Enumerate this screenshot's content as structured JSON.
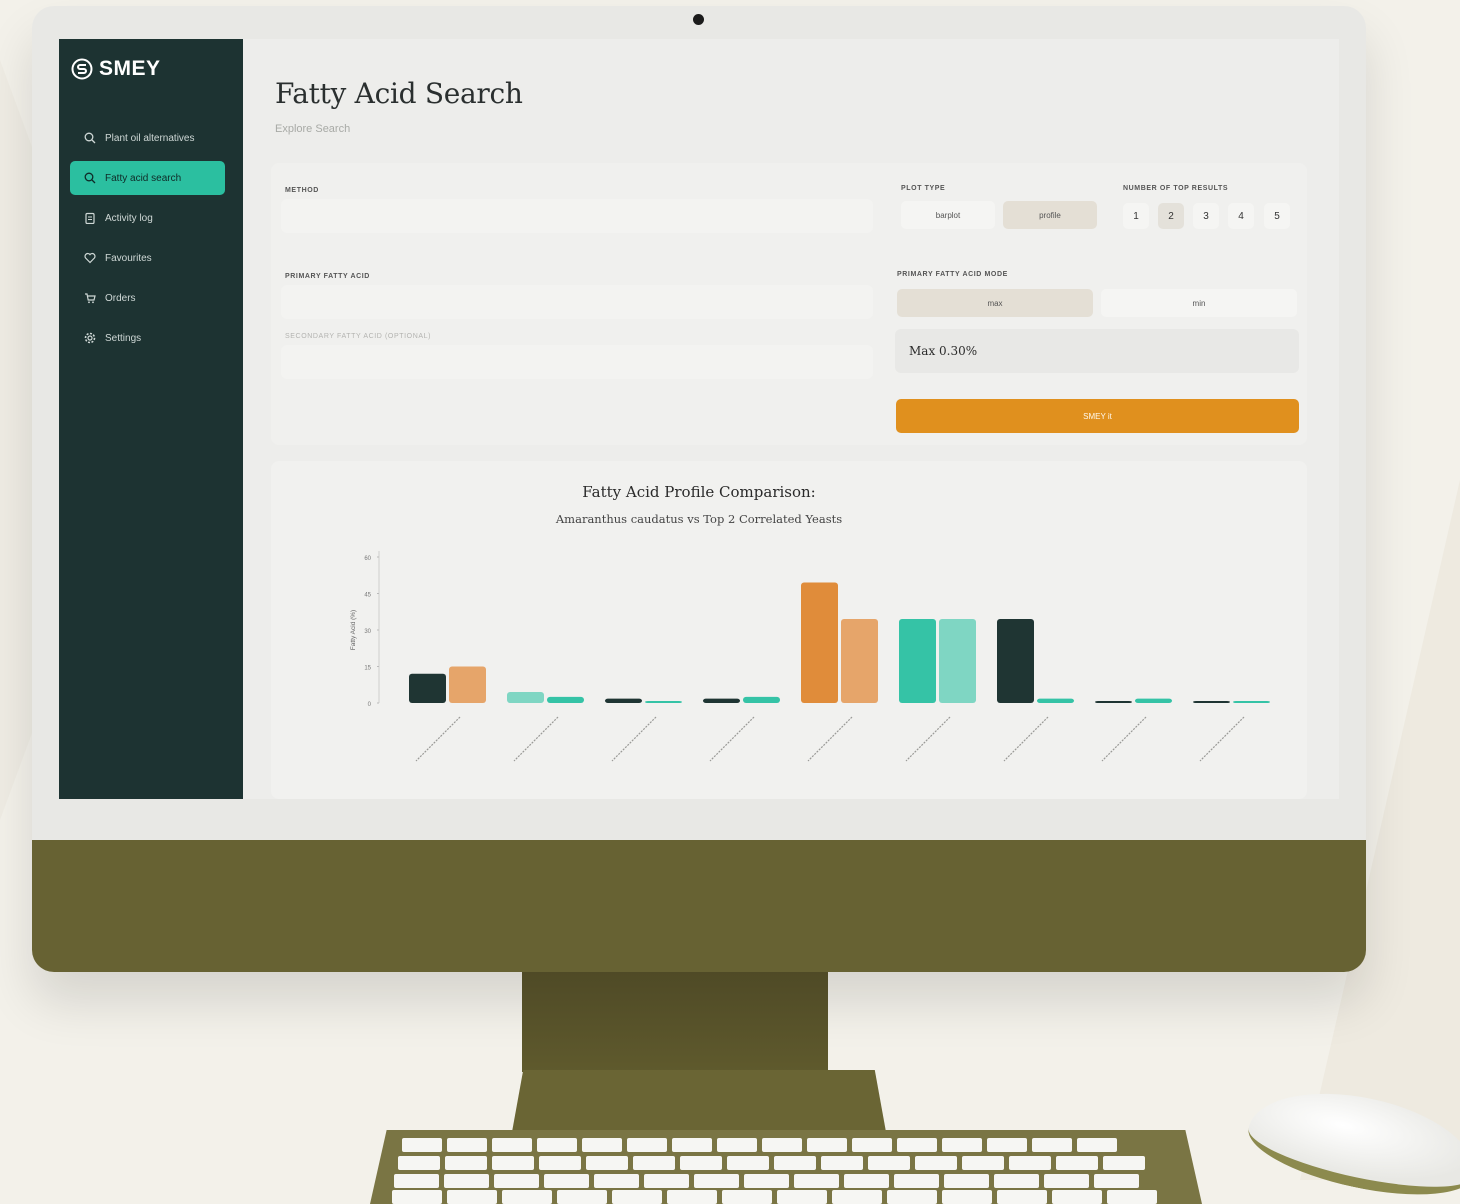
{
  "brand": {
    "name": "SMEY"
  },
  "sidebar": {
    "items": [
      {
        "label": "Plant oil alternatives",
        "icon": "search-icon",
        "active": false
      },
      {
        "label": "Fatty acid search",
        "icon": "search-icon",
        "active": true
      },
      {
        "label": "Activity log",
        "icon": "clipboard-icon",
        "active": false
      },
      {
        "label": "Favourites",
        "icon": "heart-icon",
        "active": false
      },
      {
        "label": "Orders",
        "icon": "cart-icon",
        "active": false
      },
      {
        "label": "Settings",
        "icon": "gear-icon",
        "active": false
      }
    ]
  },
  "page": {
    "title": "Fatty Acid Search",
    "breadcrumb": "Explore Search"
  },
  "form": {
    "method_label": "METHOD",
    "plot_type_label": "PLOT TYPE",
    "plot_types": [
      "barplot",
      "profile"
    ],
    "plot_type_selected": "profile",
    "top_results_label": "NUMBER OF TOP RESULTS",
    "top_results_options": [
      "1",
      "2",
      "3",
      "4",
      "5"
    ],
    "top_results_selected": "2",
    "primary_label": "PRIMARY FATTY ACID",
    "primary_mode_label": "PRIMARY FATTY ACID MODE",
    "modes": [
      "max",
      "min"
    ],
    "mode_selected": "max",
    "secondary_label": "SECONDARY FATTY ACID (OPTIONAL)",
    "max_value": "Max 0.30%",
    "submit_label": "SMEY it"
  },
  "colors": {
    "sidebar": "#1d3332",
    "accent": "#2bbfa0",
    "orange": "#e0901e",
    "dark_series": "#1f3533",
    "orange_series": "#e08c3a",
    "orange_light": "#e6a56a",
    "teal_series": "#35c3a6",
    "teal_light": "#7fd6c3"
  },
  "chart_data": {
    "type": "bar",
    "title": "Fatty Acid Profile Comparison:",
    "subtitle": "Amaranthus caudatus vs Top 2 Correlated Yeasts",
    "ylabel": "Fatty Acid (%)",
    "ylim": [
      0,
      60
    ],
    "yticks": [
      0,
      15,
      30,
      45,
      60
    ],
    "categories": [
      "",
      "",
      "",
      "",
      "",
      "",
      "",
      "",
      ""
    ],
    "bars": [
      {
        "cat": 0,
        "value": 12,
        "color": "#1f3533"
      },
      {
        "cat": 0,
        "value": 15,
        "color": "#e6a56a"
      },
      {
        "cat": 1,
        "value": 4.5,
        "color": "#7fd6c3"
      },
      {
        "cat": 1,
        "value": 2.5,
        "color": "#35c3a6"
      },
      {
        "cat": 2,
        "value": 1.8,
        "color": "#1f3533"
      },
      {
        "cat": 2,
        "value": 0.8,
        "color": "#35c3a6"
      },
      {
        "cat": 3,
        "value": 1.8,
        "color": "#1f3533"
      },
      {
        "cat": 3,
        "value": 2.5,
        "color": "#35c3a6"
      },
      {
        "cat": 4,
        "value": 49.5,
        "color": "#e08c3a"
      },
      {
        "cat": 4,
        "value": 34.5,
        "color": "#e6a56a"
      },
      {
        "cat": 5,
        "value": 34.5,
        "color": "#35c3a6"
      },
      {
        "cat": 5,
        "value": 34.5,
        "color": "#7fd6c3"
      },
      {
        "cat": 6,
        "value": 34.5,
        "color": "#1f3533"
      },
      {
        "cat": 6,
        "value": 1.8,
        "color": "#35c3a6"
      },
      {
        "cat": 7,
        "value": 0.7,
        "color": "#1f3533"
      },
      {
        "cat": 7,
        "value": 1.8,
        "color": "#35c3a6"
      },
      {
        "cat": 8,
        "value": 0.7,
        "color": "#1f3533"
      },
      {
        "cat": 8,
        "value": 0.7,
        "color": "#35c3a6"
      }
    ],
    "grid": false,
    "legend": "none"
  }
}
